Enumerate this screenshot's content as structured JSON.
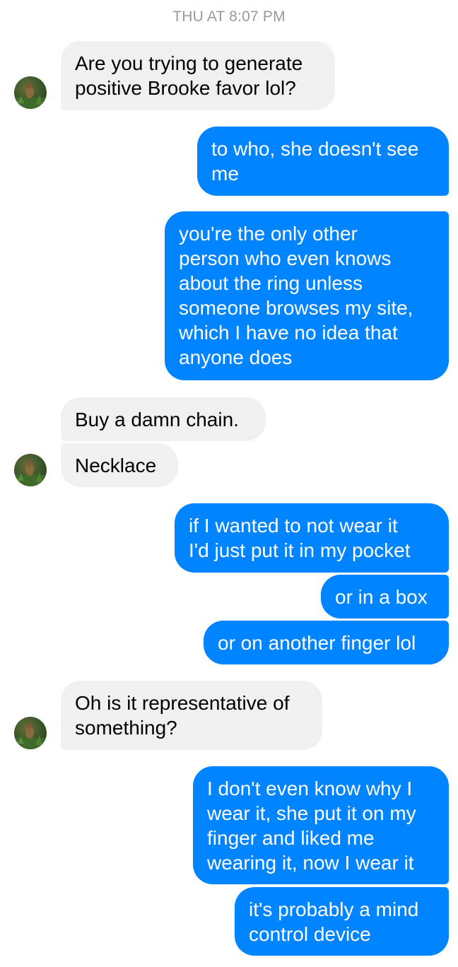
{
  "conversation": {
    "timestamp": "THU AT 8:07 PM",
    "messages": [
      {
        "id": "m1",
        "sender": "contact",
        "text": "Are you trying to generate\npositive Brooke favor lol?"
      },
      {
        "id": "m2",
        "sender": "me",
        "text": "to who, she doesn't see\nme"
      },
      {
        "id": "m3",
        "sender": "me",
        "text": "you're the only other\nperson who even knows\nabout the ring unless\nsomeone browses my site,\nwhich I have no idea that\nanyone does"
      },
      {
        "id": "m4",
        "sender": "contact",
        "text": "Buy a damn chain."
      },
      {
        "id": "m5",
        "sender": "contact",
        "text": "Necklace"
      },
      {
        "id": "m6",
        "sender": "me",
        "text": "if I wanted to not wear it\nI'd just put it in my pocket"
      },
      {
        "id": "m7",
        "sender": "me",
        "text": "or in a box"
      },
      {
        "id": "m8",
        "sender": "me",
        "text": "or on another finger lol"
      },
      {
        "id": "m9",
        "sender": "contact",
        "text": "Oh is it representative of\nsomething?"
      },
      {
        "id": "m10",
        "sender": "me",
        "text": "I don't even know why I\nwear it, she put it on my\nfinger and liked me\nwearing it, now I wear it"
      },
      {
        "id": "m11",
        "sender": "me",
        "text": "it's probably a mind\ncontrol device"
      }
    ]
  },
  "colors": {
    "outgoing_bubble": "#0084ff",
    "incoming_bubble": "#f1f0f0",
    "timestamp_text": "#9a9a9a"
  },
  "icons": {
    "contact_avatar": "contact-avatar-photo"
  }
}
